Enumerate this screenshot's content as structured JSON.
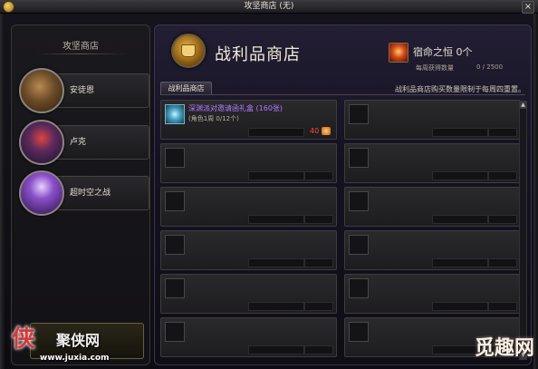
{
  "window": {
    "title": "攻坚商店 (无)"
  },
  "sidebar": {
    "title": "攻坚商店",
    "npcs": [
      {
        "label": "安徒恩"
      },
      {
        "label": "卢克"
      },
      {
        "label": "超时空之战"
      }
    ]
  },
  "main": {
    "shop_title": "战利品商店",
    "currency": {
      "name": "宿命之恒 0个",
      "weekly_label": "每周获得数量",
      "weekly_value": "0 / 2500"
    },
    "tab_label": "战利品商店",
    "limit_note": "战利品商店购买数量限制于每周四重置。",
    "items": [
      {
        "name": "深渊派对邀请函礼盒 (160张)",
        "sub": "(角色1周 0/12个)",
        "price": "40"
      }
    ]
  },
  "watermark": {
    "left_glyph": "侠",
    "left_brand": "聚侠网",
    "left_url": "www.juxia.com",
    "right_text": "觅趣网"
  },
  "colors": {
    "item_name": "#b57bff",
    "price": "#ff4a3a",
    "accent_gold": "#e7b64a"
  }
}
